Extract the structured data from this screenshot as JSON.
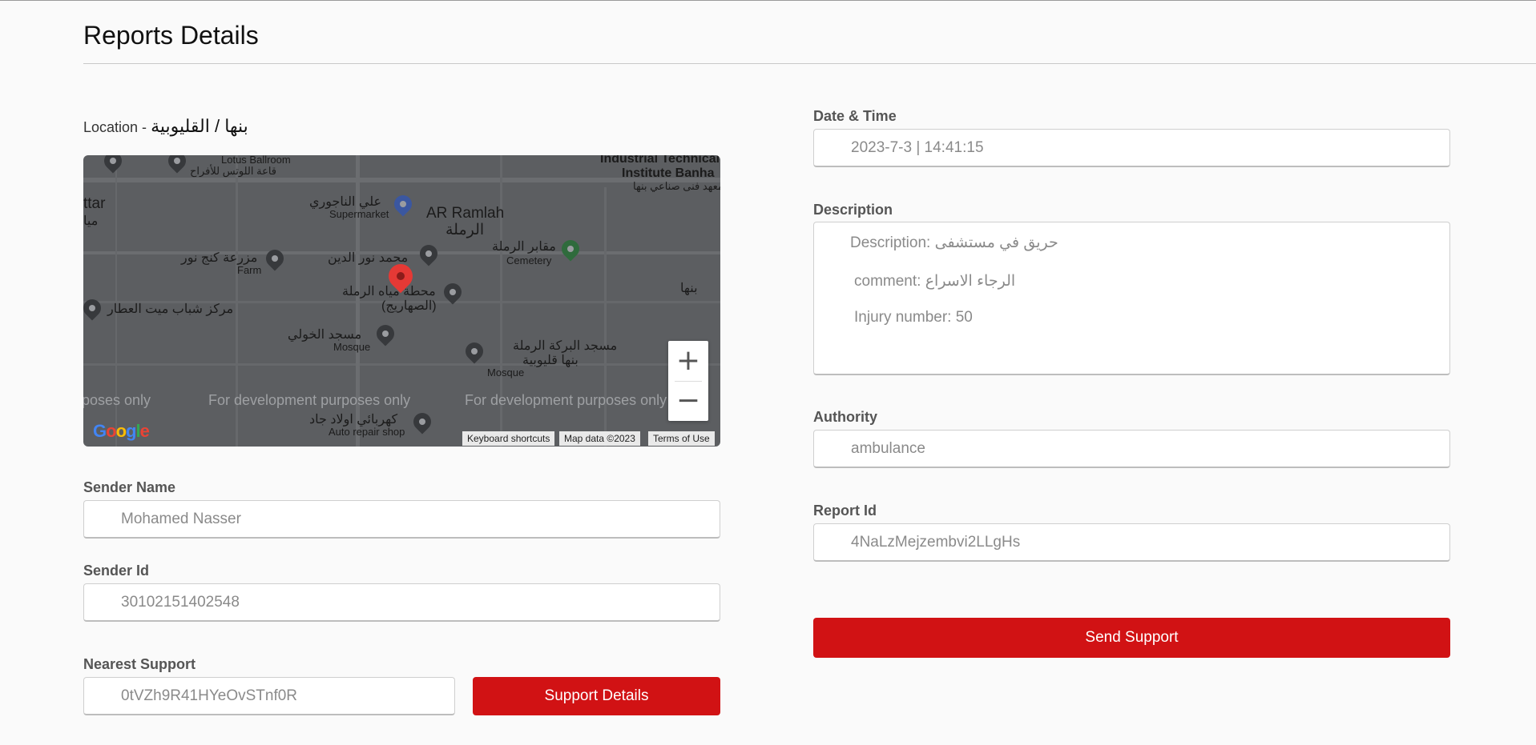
{
  "page": {
    "title": "Reports Details"
  },
  "location": {
    "label": "Location - ",
    "value": "بنها / القليوبية"
  },
  "map": {
    "labels": {
      "lotus": "Lotus Ballroom",
      "lotus_ar": "قاعة اللوتس للأفراح",
      "industrial": "Industrial Technical",
      "institute": "Institute Banha",
      "institute_ar": "معهد فنى صناعي بنها",
      "attar": "ttar",
      "attar_ar": "ميا",
      "aly": "علي الناجوري",
      "supermarket": "Supermarket",
      "ramlah": "AR Ramlah",
      "ramlah_ar": "الرملة",
      "farm_ar": "مزرعة كنج نور",
      "farm": "Farm",
      "mohamed": "محمد نور الدين",
      "cemetery_ar": "مقابر الرملة",
      "cemetery": "Cemetery",
      "mahata": "محطة مياه الرملة",
      "sahareeg": "(الصهاريج)",
      "youth_ar": "مركز شباب ميت العطار",
      "banha_edge": "بنها",
      "khouly_ar": "مسجد الخولي",
      "mosque1": "Mosque",
      "baraka_ar": "مسجد البركة الرملة",
      "baraka2_ar": "بنها قليوبية",
      "mosque2": "Mosque",
      "kahraba_ar": "كهربائي اولاد جاد",
      "auto": "Auto repair shop"
    },
    "dev_text": [
      "rposes only",
      "For development purposes only",
      "For development purposes only"
    ],
    "google": "Google",
    "attribution": [
      "Keyboard shortcuts",
      "Map data ©2023",
      "Terms of Use"
    ],
    "zoom_in": "+",
    "zoom_out": "−"
  },
  "sender_name": {
    "label": "Sender Name",
    "value": "Mohamed Nasser"
  },
  "sender_id": {
    "label": "Sender Id",
    "value": "30102151402548"
  },
  "nearest_support": {
    "label": "Nearest Support",
    "value": "0tVZh9R41HYeOvSTnf0R",
    "button": "Support Details"
  },
  "datetime": {
    "label": "Date & Time",
    "value": "2023-7-3 | 14:41:15"
  },
  "description": {
    "label": "Description",
    "line1": "Description: حريق في مستشفى",
    "line2": "comment: الرجاء الاسراع",
    "line3": "Injury number: 50"
  },
  "authority": {
    "label": "Authority",
    "value": "ambulance"
  },
  "report_id": {
    "label": "Report Id",
    "value": "4NaLzMejzembvi2LLgHs"
  },
  "send_button": "Send Support",
  "colors": {
    "accent": "#d11214",
    "map_bg": "#5c5e61",
    "pin": "#e53935"
  }
}
